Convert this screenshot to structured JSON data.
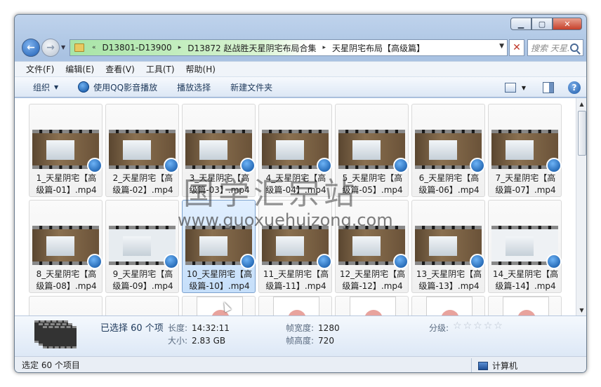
{
  "address": {
    "crumbs": [
      "D13801-D13900",
      "D13872 赵战胜天星阴宅布局合集",
      "天星阴宅布局【高级篇】"
    ],
    "chevron": "«",
    "separator": "▸"
  },
  "search": {
    "placeholder": "搜索 天星..."
  },
  "menu": [
    "文件(F)",
    "编辑(E)",
    "查看(V)",
    "工具(T)",
    "帮助(H)"
  ],
  "toolbar": {
    "organize": "组织",
    "play_qq": "使用QQ影音播放",
    "play_selection": "播放选择",
    "new_folder": "新建文件夹"
  },
  "files": [
    {
      "l1": "1_天星阴宅【高",
      "l2": "级篇-01】.mp4"
    },
    {
      "l1": "2_天星阴宅【高",
      "l2": "级篇-02】.mp4"
    },
    {
      "l1": "3_天星阴宅【高",
      "l2": "级篇-03】.mp4"
    },
    {
      "l1": "4_天星阴宅【高",
      "l2": "级篇-04】.mp4"
    },
    {
      "l1": "5_天星阴宅【高",
      "l2": "级篇-05】.mp4"
    },
    {
      "l1": "6_天星阴宅【高",
      "l2": "级篇-06】.mp4"
    },
    {
      "l1": "7_天星阴宅【高",
      "l2": "级篇-07】.mp4"
    },
    {
      "l1": "8_天星阴宅【高",
      "l2": "级篇-08】.mp4"
    },
    {
      "l1": "9_天星阴宅【高",
      "l2": "级篇-09】.mp4"
    },
    {
      "l1": "10_天星阴宅【高",
      "l2": "级篇-10】.mp4"
    },
    {
      "l1": "11_天星阴宅【高",
      "l2": "级篇-11】.mp4"
    },
    {
      "l1": "12_天星阴宅【高",
      "l2": "级篇-12】.mp4"
    },
    {
      "l1": "13_天星阴宅【高",
      "l2": "级篇-13】.mp4"
    },
    {
      "l1": "14_天星阴宅【高",
      "l2": "级篇-14】.mp4"
    }
  ],
  "watermark": {
    "text1": "国学汇宗站",
    "text2": "www.guoxuehuizong.com"
  },
  "details": {
    "selected": "已选择 60 个项",
    "length_label": "长度:",
    "length": "14:32:11",
    "size_label": "大小:",
    "size": "2.83 GB",
    "width_label": "帧宽度:",
    "width": "1280",
    "height_label": "帧高度:",
    "height": "720",
    "rating_label": "分级:",
    "rating_stars": 0
  },
  "status": {
    "left": "选定 60 个项目",
    "right": "计算机"
  },
  "colors": {
    "accent": "#1c5aa8",
    "selected_tile": "#c6dffa"
  }
}
